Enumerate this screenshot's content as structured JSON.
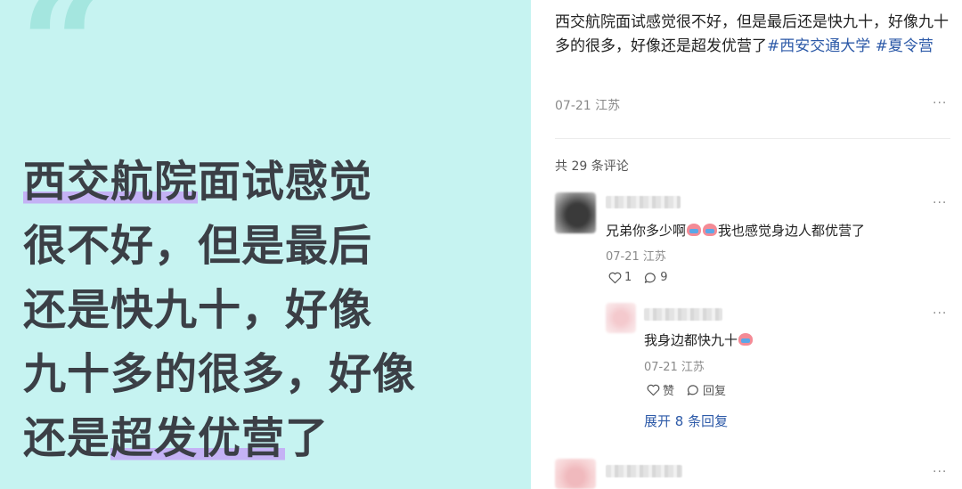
{
  "card": {
    "quote": "“",
    "lines": [
      {
        "pre": "",
        "hl": "西交航院",
        "post": "面试感觉"
      },
      {
        "pre": "很不好，但是最后",
        "hl": "",
        "post": ""
      },
      {
        "pre": "还是快九十，好像",
        "hl": "",
        "post": ""
      },
      {
        "pre": "九十多的很多，好像",
        "hl": "",
        "post": ""
      },
      {
        "pre": "还是",
        "hl": "超发优营",
        "post": "了"
      }
    ],
    "bg_color": "#c6f3f1",
    "highlight_color": "#c4b2f5"
  },
  "post": {
    "text": "西交航院面试感觉很不好，但是最后还是快九十，好像九十多的很多，好像还是超发优营了",
    "tag1": "#西安交通大学",
    "tag2": "#夏令营",
    "date_location": "07-21 江苏",
    "more": "···"
  },
  "comments_header": "共 29 条评论",
  "comments": [
    {
      "text_pre": "兄弟你多少啊",
      "text_post": "我也感觉身边人都优营了",
      "date_location": "07-21 江苏",
      "likes": "1",
      "replies": "9",
      "more": "···"
    }
  ],
  "reply": {
    "text": "我身边都快九十",
    "date_location": "07-21 江苏",
    "like_label": "赞",
    "reply_label": "回复",
    "more": "···"
  },
  "expand_label": "展开 8 条回复",
  "third_more": "···",
  "icons": {
    "like": "heart-outline-icon",
    "comment": "speech-bubble-icon",
    "emoji": "crying-face-emoji"
  }
}
